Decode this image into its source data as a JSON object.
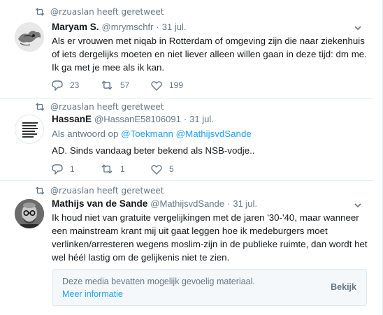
{
  "tweets": [
    {
      "retweet_context": "@rzuaslan heeft geretweet",
      "fullname": "Maryam S.",
      "username": "@mrymschfr",
      "dot": "·",
      "time": "31 jul.",
      "text_lines": [
        "Als er vrouwen met niqab in Rotterdam of omgeving zijn die naar ziekenhuis",
        "of iets dergelijks moeten en niet liever alleen willen gaan in deze tijd: dm me.",
        "Ik ga met je mee als ik kan."
      ],
      "replies": "23",
      "retweets": "57",
      "likes": "199"
    },
    {
      "retweet_context": "@rzuaslan heeft geretweet",
      "fullname": "HassanE",
      "username": "@HassanE58106091",
      "dot": "·",
      "time": "31 jul.",
      "reply_prefix": "Als antwoord op",
      "reply_mentions": [
        "@Toekmann",
        "@MathijsvdSande"
      ],
      "text_lines": [
        "AD. Sinds vandaag beter bekend als NSB-vodje.."
      ],
      "replies": "1",
      "retweets": "1",
      "likes": "5"
    },
    {
      "retweet_context": "@rzuaslan heeft geretweet",
      "fullname": "Mathijs van de Sande",
      "username": "@MathijsvdSande",
      "dot": "·",
      "time": "31 jul.",
      "text_lines": [
        "Ik houd niet van gratuite vergelijkingen met de jaren '30-'40, maar wanneer",
        "een mainstream krant mij uit gaat leggen hoe ik medeburgers moet",
        "verlinken/arresteren wegens moslim-zijn in de publieke ruimte, dan wordt het",
        "wel héél lastig om de gelijkenis niet te zien."
      ],
      "media_warning": {
        "message": "Deze media bevatten mogelijk gevoelig materiaal.",
        "more_link": "Meer informatie",
        "view_button": "Bekijk"
      }
    }
  ],
  "colors": {
    "link": "#1da1f2",
    "secondary": "#657786",
    "text": "#14171a",
    "border": "#e6ecf0"
  },
  "icons": [
    "retweet-icon",
    "reply-icon",
    "like-icon",
    "chevron-down-icon"
  ]
}
